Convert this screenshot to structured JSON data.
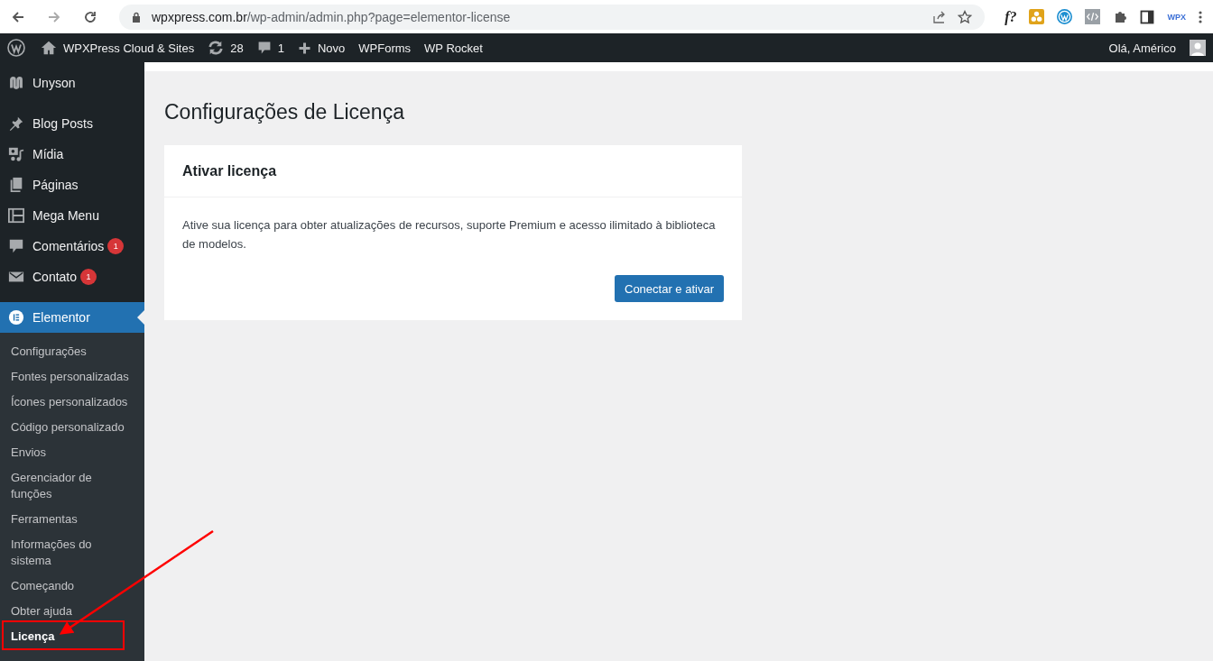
{
  "browser": {
    "url_host": "wpxpress.com.br",
    "url_path": "/wp-admin/admin.php?page=elementor-license",
    "extension_label": "f?",
    "wpx_label": "WPX"
  },
  "admin_bar": {
    "items": [
      {
        "kind": "site",
        "label": "WPXPress Cloud & Sites"
      },
      {
        "kind": "updates",
        "label": "28"
      },
      {
        "kind": "comments",
        "label": "1"
      },
      {
        "kind": "new",
        "label": "Novo"
      },
      {
        "kind": "plain",
        "label": "WPForms"
      },
      {
        "kind": "plain",
        "label": "WP Rocket"
      }
    ],
    "greeting": "Olá, Américo"
  },
  "menu": [
    {
      "kind": "unyson",
      "label": "Unyson",
      "selected": false,
      "separator_before": false
    },
    {
      "kind": "pin",
      "label": "Blog Posts",
      "selected": false,
      "separator_before": true
    },
    {
      "kind": "media",
      "label": "Mídia",
      "selected": false,
      "separator_before": false
    },
    {
      "kind": "pages",
      "label": "Páginas",
      "selected": false,
      "separator_before": false
    },
    {
      "kind": "mega",
      "label": "Mega Menu",
      "selected": false,
      "separator_before": false
    },
    {
      "kind": "comment",
      "label": "Comentários",
      "selected": false,
      "separator_before": false,
      "badge": "1"
    },
    {
      "kind": "mail",
      "label": "Contato",
      "selected": false,
      "separator_before": false,
      "badge": "1"
    },
    {
      "kind": "elementor",
      "label": "Elementor",
      "selected": true,
      "separator_before": true
    }
  ],
  "submenu": [
    {
      "label": "Configurações",
      "selected": false,
      "highlighted": false
    },
    {
      "label": "Fontes personalizadas",
      "selected": false,
      "highlighted": false
    },
    {
      "label": "Ícones personalizados",
      "selected": false,
      "highlighted": false
    },
    {
      "label": "Código personalizado",
      "selected": false,
      "highlighted": false
    },
    {
      "label": "Envios",
      "selected": false,
      "highlighted": false
    },
    {
      "label": "Gerenciador de funções",
      "selected": false,
      "highlighted": false
    },
    {
      "label": "Ferramentas",
      "selected": false,
      "highlighted": false
    },
    {
      "label": "Informações do sistema",
      "selected": false,
      "highlighted": false
    },
    {
      "label": "Começando",
      "selected": false,
      "highlighted": false
    },
    {
      "label": "Obter ajuda",
      "selected": false,
      "highlighted": false
    },
    {
      "label": "Licença",
      "selected": true,
      "highlighted": true
    }
  ],
  "page": {
    "title": "Configurações de Licença",
    "card": {
      "title": "Ativar licença",
      "text": "Ative sua licença para obter atualizações de recursos, suporte Premium e acesso ilimitado à biblioteca de modelos.",
      "button": "Conectar e ativar"
    }
  }
}
